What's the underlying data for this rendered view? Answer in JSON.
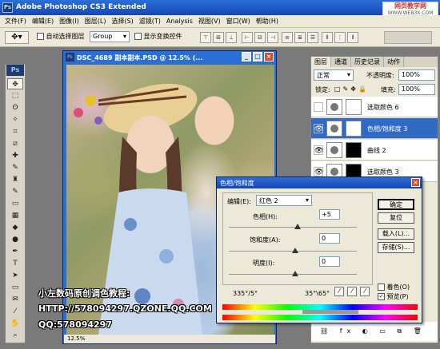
{
  "app": {
    "title": "Adobe Photoshop CS3 Extended",
    "logo_mini": "Ps",
    "watermark_line1": "网页教学网",
    "watermark_line2": "WWW.WEB3X.COM"
  },
  "menu": [
    "文件(F)",
    "编辑(E)",
    "图像(I)",
    "图层(L)",
    "选择(S)",
    "滤镜(T)",
    "Analysis",
    "视图(V)",
    "窗口(W)",
    "帮助(H)"
  ],
  "options": {
    "auto_select_label": "自动选择图层",
    "auto_select_value": "Group",
    "show_transform_label": "显示变换控件"
  },
  "toolbox": {
    "logo": "Ps",
    "tools": [
      "move-tool",
      "marquee-tool",
      "lasso-tool",
      "magic-wand-tool",
      "crop-tool",
      "slice-tool",
      "healing-brush-tool",
      "brush-tool",
      "clone-stamp-tool",
      "history-brush-tool",
      "eraser-tool",
      "gradient-tool",
      "blur-tool",
      "dodge-tool",
      "pen-tool",
      "type-tool",
      "path-selection-tool",
      "shape-tool",
      "notes-tool",
      "eyedropper-tool",
      "hand-tool",
      "zoom-tool"
    ],
    "tool_glyphs": [
      "✥",
      "⬚",
      "ʘ",
      "✧",
      "⌗",
      "⧄",
      "✚",
      "✎",
      "♜",
      "✎",
      "▭",
      "▦",
      "◆",
      "●",
      "✒",
      "T",
      "➤",
      "▭",
      "✉",
      "⁄",
      "✋",
      "⌕"
    ]
  },
  "document": {
    "title": "DSC_4689 副本副本.PSD @ 12.5% (...",
    "zoom": "12.5%",
    "tutorial_line1": "小左数码原创调色教程:",
    "tutorial_line2": "HTTP://578094297.QZONE.QQ.COM",
    "tutorial_line3": "QQ:578094297"
  },
  "layers_panel": {
    "tabs": [
      "图层",
      "通道",
      "历史记录",
      "动作"
    ],
    "blend_mode": "正常",
    "opacity_label": "不透明度:",
    "opacity_value": "100%",
    "lock_label": "锁定:",
    "fill_label": "填充:",
    "fill_value": "100%",
    "layers": [
      {
        "name": "选取颜色 6",
        "visible": false,
        "active": false
      },
      {
        "name": "色相/饱和度 3",
        "visible": true,
        "active": true
      },
      {
        "name": "曲线 2",
        "visible": true,
        "active": false
      },
      {
        "name": "选取颜色 3",
        "visible": true,
        "active": false
      }
    ]
  },
  "hue_dialog": {
    "title": "色相/饱和度",
    "edit_label": "编辑(E):",
    "edit_value": "红色 2",
    "hue_label": "色相(H):",
    "hue_value": "+5",
    "saturation_label": "饱和度(A):",
    "saturation_value": "0",
    "lightness_label": "明度(I):",
    "lightness_value": "0",
    "range_left": "335°/5°",
    "range_right": "35°\\65°",
    "buttons": {
      "ok": "确定",
      "reset": "复位",
      "load": "载入(L)...",
      "save": "存储(S)..."
    },
    "colorize_label": "着色(O)",
    "preview_label": "预览(P)"
  }
}
